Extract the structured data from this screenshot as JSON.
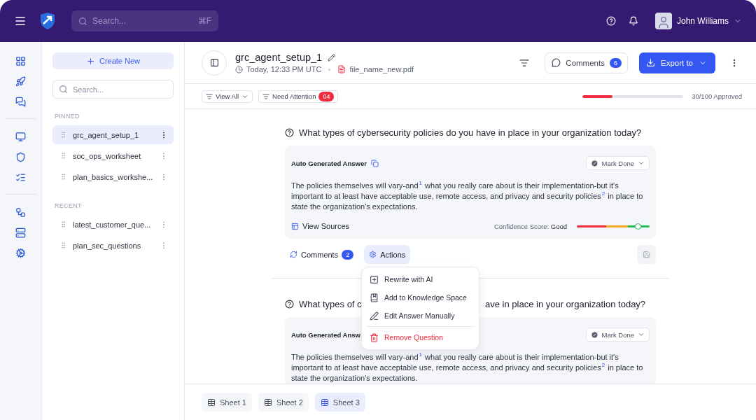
{
  "top_bar": {
    "search": {
      "placeholder": "Search...",
      "shortcut": "⌘F"
    },
    "user": {
      "name": "John Williams"
    }
  },
  "sidebar": {
    "create_button": "Create New",
    "search": {
      "placeholder": "Search..."
    },
    "sections": [
      {
        "title": "PINNED",
        "items": [
          {
            "label": "grc_agent_setup_1",
            "selected": true
          },
          {
            "label": "soc_ops_worksheet",
            "selected": false
          },
          {
            "label": "plan_basics_workshe...",
            "selected": false
          }
        ]
      },
      {
        "title": "RECENT",
        "items": [
          {
            "label": "latest_customer_que...",
            "selected": false
          },
          {
            "label": "plan_sec_questions",
            "selected": false
          }
        ]
      }
    ]
  },
  "document": {
    "title": "grc_agent_setup_1",
    "timestamp": "Today, 12:33 PM UTC",
    "file": "file_name_new.pdf",
    "comments": {
      "label": "Comments",
      "count": "6"
    },
    "export_button": "Export to"
  },
  "filters": [
    {
      "label": "View All",
      "kind": "dropdown"
    },
    {
      "label": "Need Attention",
      "kind": "count",
      "count": "04"
    }
  ],
  "progress": {
    "level": 0.3,
    "label": "30/100 Approved"
  },
  "questions": [
    {
      "question_parts": [
        "What types of cybersecurity policies do you have in place in your organization today?"
      ],
      "answer_label": "Auto Generated Answer",
      "copy_icon": true,
      "status": "Mark Done",
      "answer": "The policies themselves will vary-and$^{1}$ what you really care about is their implementation-but it's important to at least have acceptable use, remote access, and privacy and security policies$^{2}$ in place to state the organization's expectations.",
      "footer": {
        "sources": "View Sources",
        "confidence_label": "Confidence Score:",
        "confidence_value": "Good",
        "level": 0.84
      },
      "comments": {
        "label": "Comments",
        "count": "2"
      },
      "actions": {
        "label": "Actions",
        "expanded": true
      }
    },
    {
      "question_parts": [
        "What types of c",
        "ave in place in your organization today?"
      ],
      "answer_label": "Auto Generated Answ",
      "copy_icon": false,
      "status": "Mark Done",
      "answer": "The policies themselves will vary-and$^{1}$ what you really care about is their implementation-but it's important to at least have acceptable use, remote access, and privacy and security policies$^{2}$ in place to state the organization's expectations."
    }
  ],
  "menu": {
    "items": [
      {
        "label": "Rewrite with AI",
        "kind": "rewrite"
      },
      {
        "label": "Add to Knowledge Space",
        "kind": "save"
      },
      {
        "label": "Edit Answer Manually",
        "kind": "edit"
      },
      {
        "label": "Remove Question",
        "kind": "danger"
      }
    ]
  },
  "sheets": [
    {
      "label": "Sheet 1",
      "selected": false
    },
    {
      "label": "Sheet 2",
      "selected": false
    },
    {
      "label": "Sheet 3",
      "selected": true
    }
  ]
}
